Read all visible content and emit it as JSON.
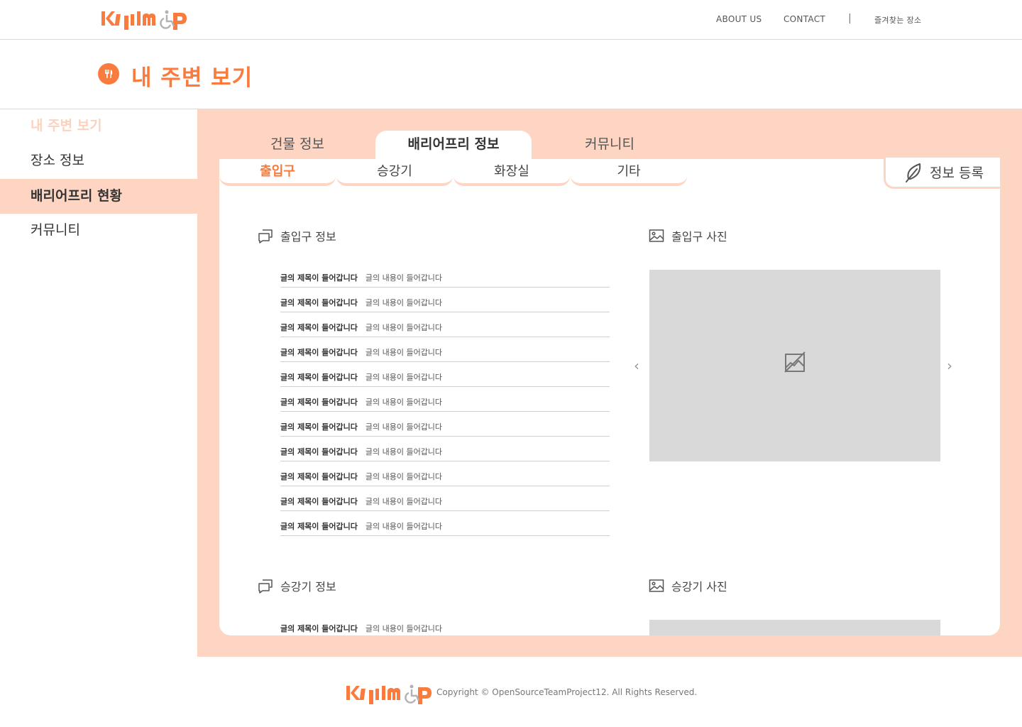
{
  "header": {
    "nav": {
      "about": "ABOUT US",
      "contact": "CONTACT",
      "separator": "|",
      "favorites": "즐겨찾는 장소"
    }
  },
  "page": {
    "title": "내 주변 보기",
    "title_icon": "fork-knife-icon"
  },
  "sidebar": {
    "items": [
      {
        "label": "내 주변 보기",
        "state": "faded"
      },
      {
        "label": "장소 정보",
        "state": "normal"
      },
      {
        "label": "배리어프리 현황",
        "state": "active"
      },
      {
        "label": "커뮤니티",
        "state": "normal"
      }
    ]
  },
  "tabs": {
    "top": [
      {
        "label": "건물 정보"
      },
      {
        "label": "배리어프리 정보",
        "active": true
      },
      {
        "label": "커뮤니티"
      }
    ],
    "sub": [
      {
        "label": "출입구",
        "active": true
      },
      {
        "label": "승강기"
      },
      {
        "label": "화장실"
      },
      {
        "label": "기타"
      }
    ],
    "register_label": "정보 등록"
  },
  "sections": {
    "entrance_info": "출입구 정보",
    "entrance_photo": "출입구 사진",
    "elevator_info": "승강기 정보",
    "elevator_photo": "승강기 사진"
  },
  "rows": [
    {
      "title": "글의 제목이 들어갑니다",
      "content": "글의 내용이 들어갑니다"
    },
    {
      "title": "글의 제목이 들어갑니다",
      "content": "글의 내용이 들어갑니다"
    },
    {
      "title": "글의 제목이 들어갑니다",
      "content": "글의 내용이 들어갑니다"
    },
    {
      "title": "글의 제목이 들어갑니다",
      "content": "글의 내용이 들어갑니다"
    },
    {
      "title": "글의 제목이 들어갑니다",
      "content": "글의 내용이 들어갑니다"
    },
    {
      "title": "글의 제목이 들어갑니다",
      "content": "글의 내용이 들어갑니다"
    },
    {
      "title": "글의 제목이 들어갑니다",
      "content": "글의 내용이 들어갑니다"
    },
    {
      "title": "글의 제목이 들어갑니다",
      "content": "글의 내용이 들어갑니다"
    },
    {
      "title": "글의 제목이 들어갑니다",
      "content": "글의 내용이 들어갑니다"
    },
    {
      "title": "글의 제목이 들어갑니다",
      "content": "글의 내용이 들어갑니다"
    },
    {
      "title": "글의 제목이 들어갑니다",
      "content": "글의 내용이 들어갑니다"
    }
  ],
  "elevator_rows": [
    {
      "title": "글의 제목이 들어갑니다",
      "content": "글의 내용이 들어갑니다"
    }
  ],
  "footer": {
    "copyright": "Copyright © OpenSourceTeamProject12. All Rights Reserved."
  },
  "colors": {
    "accent": "#f97b3d",
    "accent_light": "#fdd5c2",
    "placeholder": "#d9d9d9"
  }
}
